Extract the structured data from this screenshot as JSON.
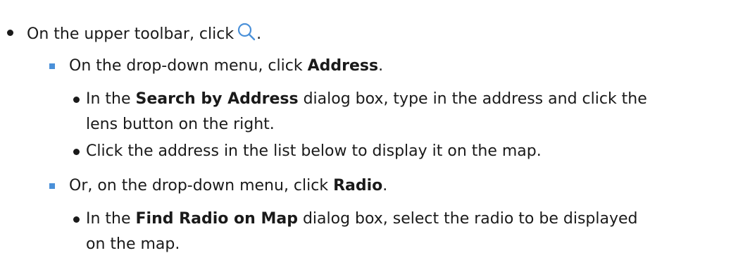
{
  "steps": {
    "l1": {
      "text_a": "On the upper toolbar, click",
      "icon": "search-icon",
      "text_b": "."
    },
    "l2": {
      "text_a": "On the drop-down menu, click ",
      "bold": "Address",
      "text_b": "."
    },
    "l3": {
      "text_a": "In the ",
      "bold": "Search by Address",
      "text_b": " dialog box, type in the address and click the"
    },
    "l4": {
      "text": "lens button on the right."
    },
    "l5": {
      "text": "Click the address in the list below to display it on the map."
    },
    "l6": {
      "text_a": "Or, on the drop-down menu, click ",
      "bold": "Radio",
      "text_b": "."
    },
    "l7": {
      "text_a": "In the ",
      "bold": "Find Radio on Map",
      "text_b": " dialog box, select the radio to be displayed"
    },
    "l8": {
      "text": "on the map."
    }
  },
  "colors": {
    "text": "#1a1a1a",
    "square_bullet": "#4a90d9",
    "icon": "#4a90d9"
  }
}
